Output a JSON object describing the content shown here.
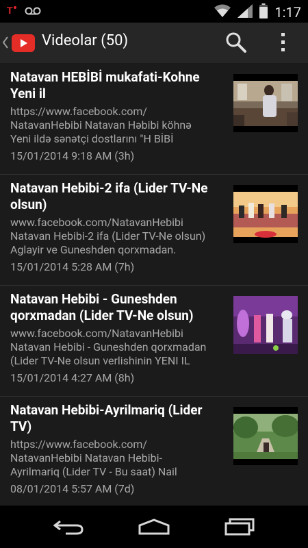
{
  "status_bar": {
    "time": "1:17",
    "icons": [
      "carrier-icon",
      "voicemail-icon",
      "wifi-icon",
      "signal-icon",
      "battery-icon"
    ]
  },
  "app_bar": {
    "title": "Videolar (50)",
    "icons": [
      "back-chevron-icon",
      "youtube-logo-icon",
      "search-icon",
      "overflow-menu-icon"
    ]
  },
  "videos": [
    {
      "title": "Natavan HEBİBİ mukafati-Kohne Yeni il",
      "description": "https://www.facebook.com/\nNatavanHebibi Natavan Həbibi köhnə\nYeni ildə sənətçi dostlarını \"H BİBİ",
      "date": "15/01/2014 9:18 AM (3h)"
    },
    {
      "title": "Natavan Hebibi-2 ifa (Lider TV-Ne olsun)",
      "description": "www.facebook.com/NatavanHebibi\nNatavan Hebibi-2 ifa (Lider TV-Ne olsun)\nAglayir ve Guneshden qorxmadan.",
      "date": "15/01/2014 5:28 AM (7h)"
    },
    {
      "title": "Natavan Hebibi - Guneshden qorxmadan (Lider TV-Ne olsun)",
      "description": "www.facebook.com/NatavanHebibi\nNatavan Hebibi - Guneshden qorxmadan\n(Lider TV-Ne olsun verlishinin YENI IL",
      "date": "15/01/2014 4:27 AM (8h)"
    },
    {
      "title": "Natavan Hebibi-Ayrilmariq (Lider TV)",
      "description": "https://www.facebook.com/\nNatavanHebibi Natavan Hebibi-\nAyrilmariq (Lider TV - Bu saat) Nail",
      "date": "08/01/2014 5:57 AM (7d)"
    }
  ],
  "nav_bar": {
    "icons": [
      "back-nav-icon",
      "home-nav-icon",
      "recent-apps-icon"
    ]
  }
}
